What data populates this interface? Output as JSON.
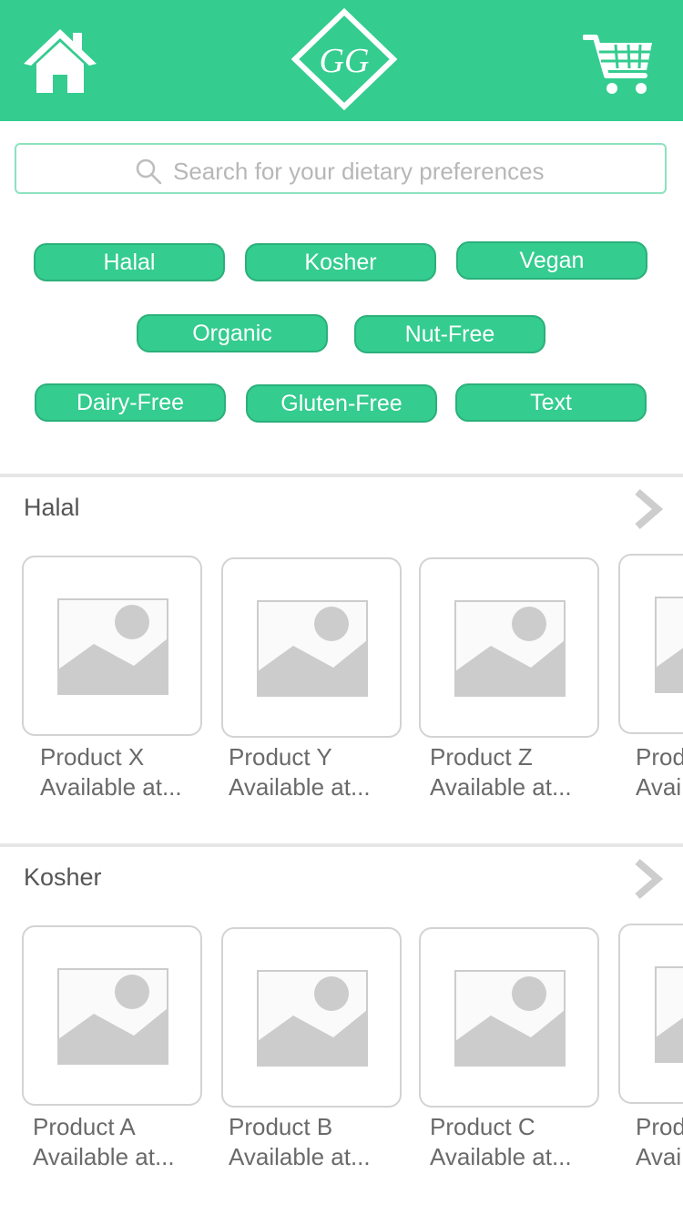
{
  "header": {
    "logo_text": "GG",
    "home_icon": "home-icon",
    "cart_icon": "shopping-cart-icon"
  },
  "search": {
    "placeholder": "Search for your dietary preferences",
    "value": ""
  },
  "filters": [
    "Halal",
    "Kosher",
    "Vegan",
    "Organic",
    "Nut-Free",
    "Dairy-Free",
    "Gluten-Free",
    "Text"
  ],
  "sections": [
    {
      "title": "Halal",
      "products": [
        {
          "name": "Product X",
          "availability": "Available at..."
        },
        {
          "name": "Product Y",
          "availability": "Available at..."
        },
        {
          "name": "Product Z",
          "availability": "Available at..."
        },
        {
          "name": "Prod",
          "availability": "Avai"
        }
      ]
    },
    {
      "title": "Kosher",
      "products": [
        {
          "name": "Product A",
          "availability": "Available at..."
        },
        {
          "name": "Product B",
          "availability": "Available at..."
        },
        {
          "name": "Product C",
          "availability": "Available at..."
        },
        {
          "name": "Prod",
          "availability": "Avai"
        }
      ]
    }
  ],
  "colors": {
    "accent": "#34cc8f",
    "placeholder_gray": "#cccccc"
  }
}
